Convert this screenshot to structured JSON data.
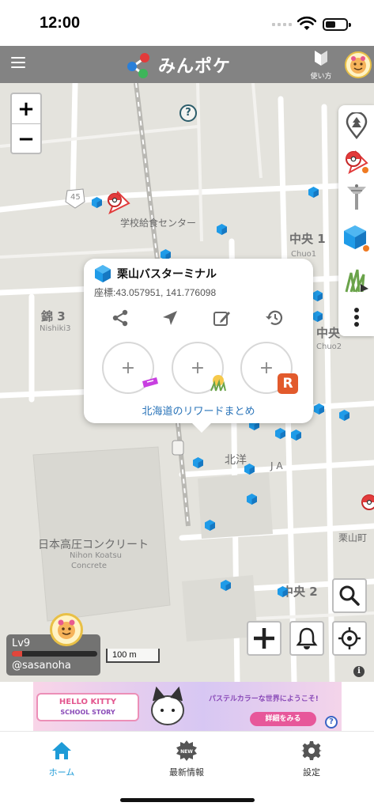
{
  "status_bar": {
    "time": "12:00"
  },
  "header": {
    "app_name": "みんポケ",
    "usage_label": "使い方"
  },
  "map": {
    "zoom_in": "+",
    "zoom_out": "−",
    "help_marker": "?",
    "road_number": "45",
    "labels": {
      "school_center": "学校給食センター",
      "nishiki3": "錦 3",
      "nishiki3_roman": "Nishiki3",
      "chuo1": "中央 1",
      "chuo1_roman": "Chuo1",
      "chuo2_partial": "中央",
      "chuo2_roman": "Chuo2",
      "hokuyo": "北洋",
      "ja": "J A",
      "kuriyama_town": "栗山町",
      "nihon_koatsu": "日本高圧コンクリート",
      "nihon_koatsu_roman1": "Nihon Koatsu",
      "nihon_koatsu_roman2": "Concrete",
      "chuo_partial_bottom": "中央 2"
    },
    "scale_label": "100 m",
    "info_label": "i"
  },
  "popup": {
    "title": "栗山バスターミナル",
    "coords": "座標:43.057951, 141.776098",
    "reward_plus": "+",
    "link": "北海道のリワードまとめ",
    "badge_letter": "R"
  },
  "player": {
    "level": "Lv9",
    "username": "@sasanoha",
    "progress": 0.12
  },
  "ad": {
    "left_text": "HELLO KITTY",
    "left_sub": "SCHOOL STORY",
    "right_text": "パステルカラーな世界にようこそ!",
    "cta": "詳細をみる",
    "choices": "?"
  },
  "nav": {
    "items": [
      {
        "label": "ホーム"
      },
      {
        "label": "最新情報",
        "badge": "NEW"
      },
      {
        "label": "設定"
      }
    ]
  },
  "colors": {
    "accent": "#1e9bd7",
    "header": "#838383",
    "cube": "#1f9be8",
    "link": "#2a74b9"
  }
}
